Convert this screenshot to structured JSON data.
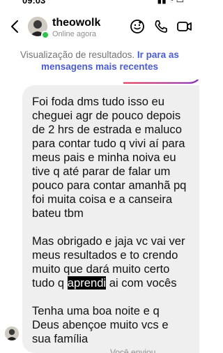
{
  "status_bar": {
    "time": "09:03",
    "icons": "signal-wifi-battery"
  },
  "header": {
    "username": "theowolk",
    "status": "Online agora",
    "icons": [
      "back-chevron-icon",
      "sticker-icon",
      "phone-icon",
      "video-camera-icon"
    ]
  },
  "notice": {
    "text": "Visualização de resultados.",
    "link": "Ir para as mensagens mais recentes"
  },
  "message": {
    "paragraph1": "Foi foda dms tudo isso eu cheguei agr de pouco depois de 2 hrs de estrada e maluco para contar tudo q vivi aí para meus pais e minha noiva eu tive q até parar de falar um pouco para contar amanhã pq foi muita coisa e a canseira bateu tbm",
    "paragraph2_before": "Mas obrigado e jaja vc vai ver meus resultados e to crendo muito que dará muito certo tudo q",
    "paragraph2_highlight": "aprendi",
    "paragraph2_after": "ai com vocês",
    "paragraph3": "Tenha uma boa noite e q Deus abençoe muito vcs e sua família"
  },
  "footer": {
    "peek_text": "Você enviou"
  },
  "colors": {
    "link_blue": "#4a5bd6",
    "online_green": "#31c24a",
    "bubble_gray": "#efefef",
    "accent_gradient": [
      "#e4405f",
      "#8a3ab9"
    ]
  }
}
